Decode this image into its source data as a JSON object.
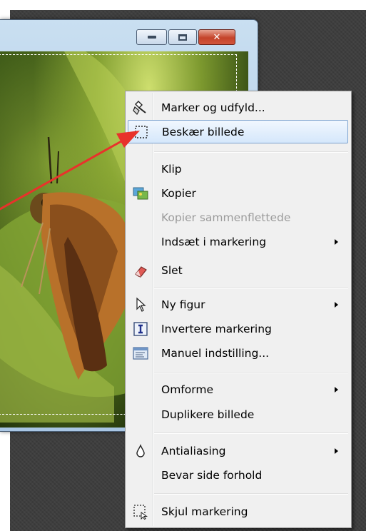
{
  "window": {
    "caption_buttons": {
      "minimize": "minimize",
      "maximize": "maximize",
      "close": "close"
    }
  },
  "context_menu": {
    "items": [
      {
        "label": "Marker og udfyld...",
        "icon": "select-fill-icon",
        "submenu": false,
        "disabled": false
      },
      {
        "label": "Beskær billede",
        "icon": "crop-selection-icon",
        "submenu": false,
        "disabled": false,
        "highlighted": true
      },
      {
        "label": "Klip",
        "icon": "",
        "submenu": false,
        "disabled": false
      },
      {
        "label": "Kopier",
        "icon": "copy-image-icon",
        "submenu": false,
        "disabled": false
      },
      {
        "label": "Kopier sammenflettede",
        "icon": "",
        "submenu": false,
        "disabled": true
      },
      {
        "label": "Indsæt i markering",
        "icon": "",
        "submenu": true,
        "disabled": false
      },
      {
        "label": "Slet",
        "icon": "eraser-icon",
        "submenu": false,
        "disabled": false
      },
      {
        "label": "Ny figur",
        "icon": "pointer-icon",
        "submenu": true,
        "disabled": false
      },
      {
        "label": "Invertere markering",
        "icon": "invert-selection-icon",
        "submenu": false,
        "disabled": false
      },
      {
        "label": "Manuel indstilling...",
        "icon": "manual-settings-icon",
        "submenu": false,
        "disabled": false
      },
      {
        "label": "Omforme",
        "icon": "",
        "submenu": true,
        "disabled": false
      },
      {
        "label": "Duplikere billede",
        "icon": "",
        "submenu": false,
        "disabled": false
      },
      {
        "label": "Antialiasing",
        "icon": "droplet-icon",
        "submenu": true,
        "disabled": false
      },
      {
        "label": "Bevar side forhold",
        "icon": "",
        "submenu": false,
        "disabled": false
      },
      {
        "label": "Skjul markering",
        "icon": "hide-selection-icon",
        "submenu": false,
        "disabled": false
      }
    ]
  },
  "colors": {
    "annotation_arrow": "#e8322b",
    "menu_highlight_border": "#7da2ce",
    "close_button": "#c4432a"
  }
}
